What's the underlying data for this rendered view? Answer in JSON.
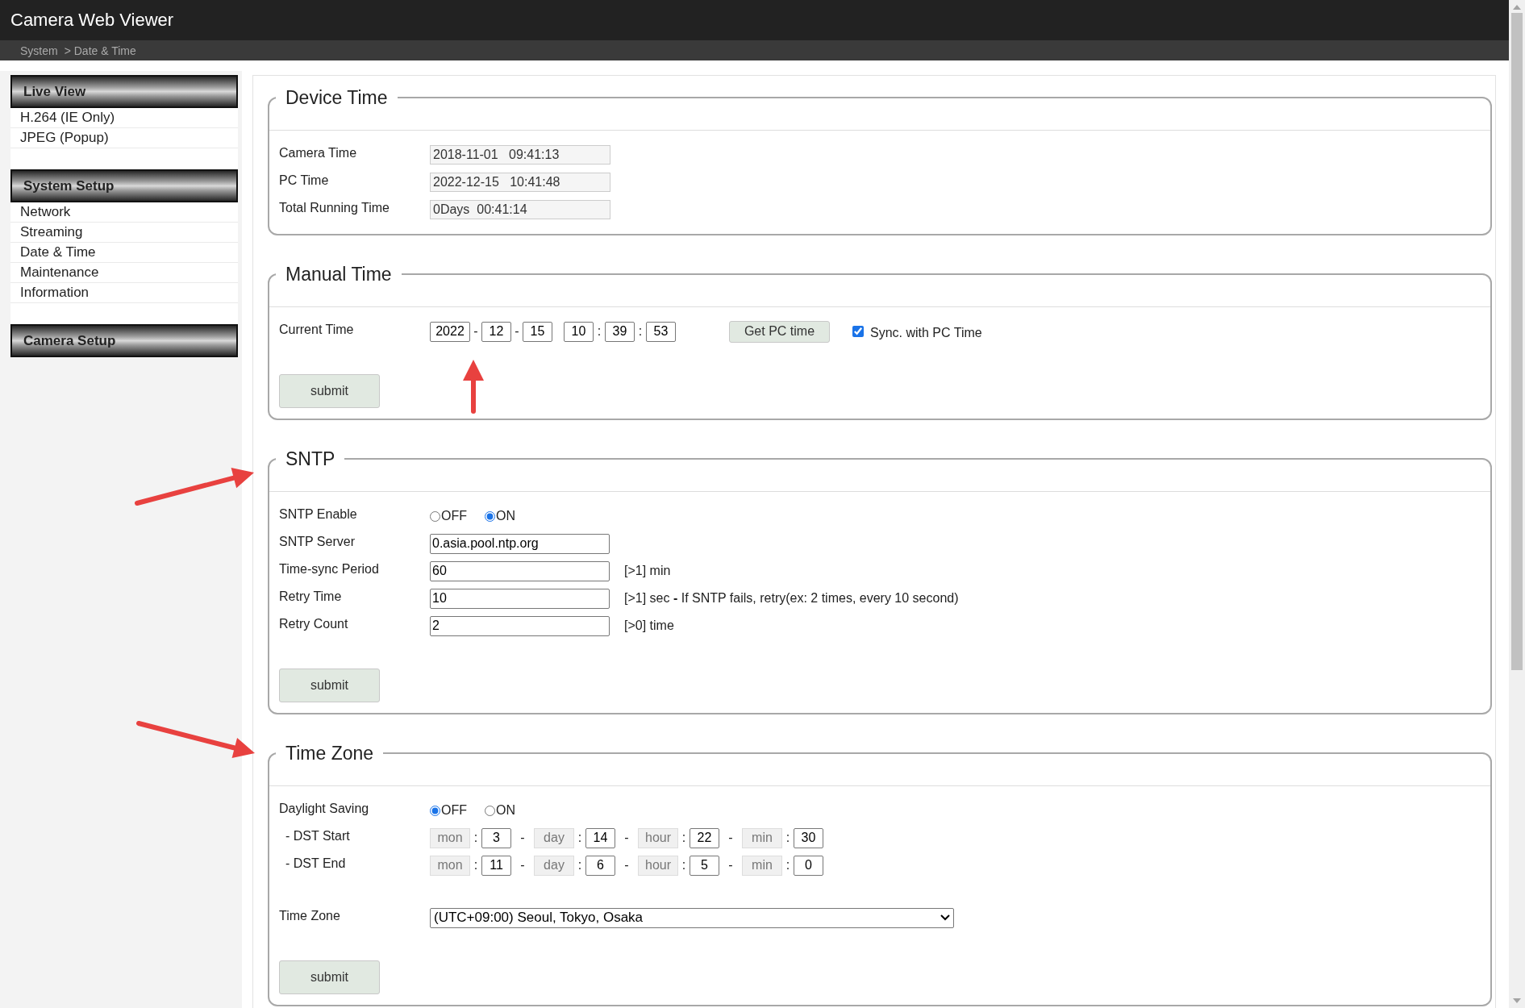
{
  "header": {
    "title": "Camera Web Viewer",
    "breadcrumb": [
      {
        "label": "System"
      },
      {
        "label": "> Date & Time"
      }
    ]
  },
  "sidebar": [
    {
      "title": "Live View",
      "items": [
        {
          "label": "H.264 (IE Only)"
        },
        {
          "label": "JPEG  (Popup)"
        }
      ]
    },
    {
      "title": "System Setup",
      "items": [
        {
          "label": "Network"
        },
        {
          "label": "Streaming"
        },
        {
          "label": "Date & Time"
        },
        {
          "label": "Maintenance"
        },
        {
          "label": "Information"
        }
      ]
    },
    {
      "title": "Camera Setup"
    }
  ],
  "device_time": {
    "title": "Device Time",
    "rows": [
      {
        "label": "Camera Time",
        "value": "2018-11-01   09:41:13"
      },
      {
        "label": "PC Time",
        "value": "2022-12-15   10:41:48"
      },
      {
        "label": "Total Running Time",
        "value": "0Days  00:41:14"
      }
    ]
  },
  "manual_time": {
    "title": "Manual Time",
    "label": "Current Time",
    "fields": [
      {
        "value": "2022",
        "sep": "-"
      },
      {
        "value": "12",
        "sep": "-"
      },
      {
        "value": "15"
      },
      {
        "value": "10",
        "sep": ":"
      },
      {
        "value": "39",
        "sep": ":"
      },
      {
        "value": "53"
      }
    ],
    "pc_button": "Get PC time",
    "sync": {
      "label": "Sync. with PC Time",
      "checked": true
    },
    "submit": "submit"
  },
  "sntp": {
    "title": "SNTP",
    "enable": {
      "label": "SNTP Enable",
      "options": [
        {
          "label": "OFF",
          "selected": false
        },
        {
          "label": "ON",
          "selected": true
        }
      ]
    },
    "rows": [
      {
        "label": "SNTP Server",
        "value": "0.asia.pool.ntp.org"
      },
      {
        "label": "Time-sync Period",
        "value": "60",
        "hint": "[>1] min"
      },
      {
        "label": "Retry Time",
        "value": "10",
        "hint": "[>1] sec **-** If SNTP fails, retry(ex: 2 times, every 10 second)"
      },
      {
        "label": "Retry Count",
        "value": "2",
        "hint": "[>0] time"
      }
    ],
    "submit": "submit"
  },
  "time_zone": {
    "title": "Time Zone",
    "daylight": {
      "label": "Daylight Saving",
      "options": [
        {
          "label": "OFF",
          "selected": true
        },
        {
          "label": "ON",
          "selected": false
        }
      ]
    },
    "dst": [
      {
        "label": "- DST Start",
        "parts": [
          {
            "unit": "mon",
            "colon": ":",
            "value": "3",
            "sep": "-"
          },
          {
            "unit": "day",
            "colon": ":",
            "value": "14",
            "sep": "-"
          },
          {
            "unit": "hour",
            "colon": ":",
            "value": "22",
            "sep": "-"
          },
          {
            "unit": "min",
            "colon": ":",
            "value": "30"
          }
        ]
      },
      {
        "label": "- DST End",
        "parts": [
          {
            "unit": "mon",
            "colon": ":",
            "value": "11",
            "sep": "-"
          },
          {
            "unit": "day",
            "colon": ":",
            "value": "6",
            "sep": "-"
          },
          {
            "unit": "hour",
            "colon": ":",
            "value": "5",
            "sep": "-"
          },
          {
            "unit": "min",
            "colon": ":",
            "value": "0"
          }
        ]
      }
    ],
    "zone": {
      "label": "Time Zone",
      "value": "(UTC+09:00) Seoul, Tokyo, Osaka"
    },
    "submit": "submit"
  }
}
